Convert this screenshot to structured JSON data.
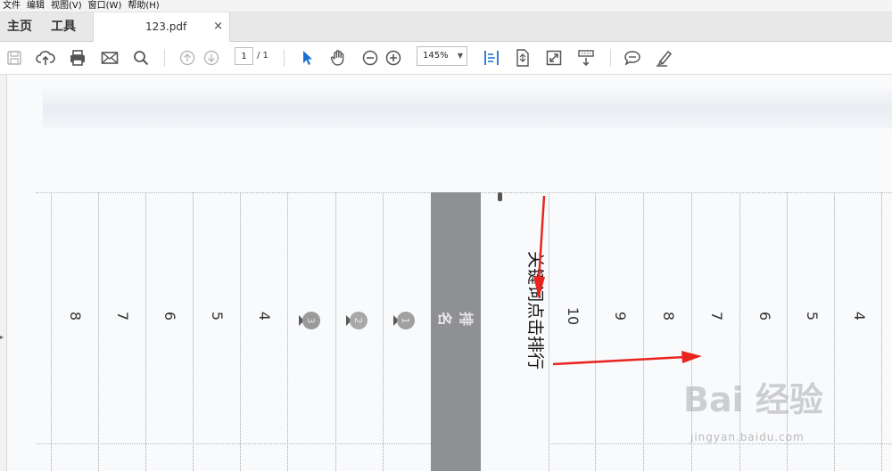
{
  "menu": [
    "文件",
    "编辑",
    "视图(V)",
    "窗口(W)",
    "帮助(H)"
  ],
  "nav_tabs": {
    "home": "主页",
    "tools": "工具"
  },
  "document_tab": {
    "name": "123.pdf",
    "close": "×"
  },
  "toolbar": {
    "page_current": "1",
    "page_total": "/ 1",
    "zoom": "145%",
    "zoom_arrow": "▼"
  },
  "page_content": {
    "title_vertical": "关键词点击排行",
    "band_label": "排名",
    "left_table_numbers": [
      "8",
      "7",
      "6",
      "5",
      "4",
      "3",
      "2",
      "1"
    ],
    "right_table_numbers": [
      "10",
      "9",
      "8",
      "7",
      "6",
      "5",
      "4"
    ]
  },
  "watermark": {
    "brand": "Bai 经验",
    "url": "jingyan.baidu.com"
  },
  "colors": {
    "annotation_arrow": "#e8261f",
    "band": "#8f9094",
    "cursor_blue": "#1b6fd1"
  }
}
